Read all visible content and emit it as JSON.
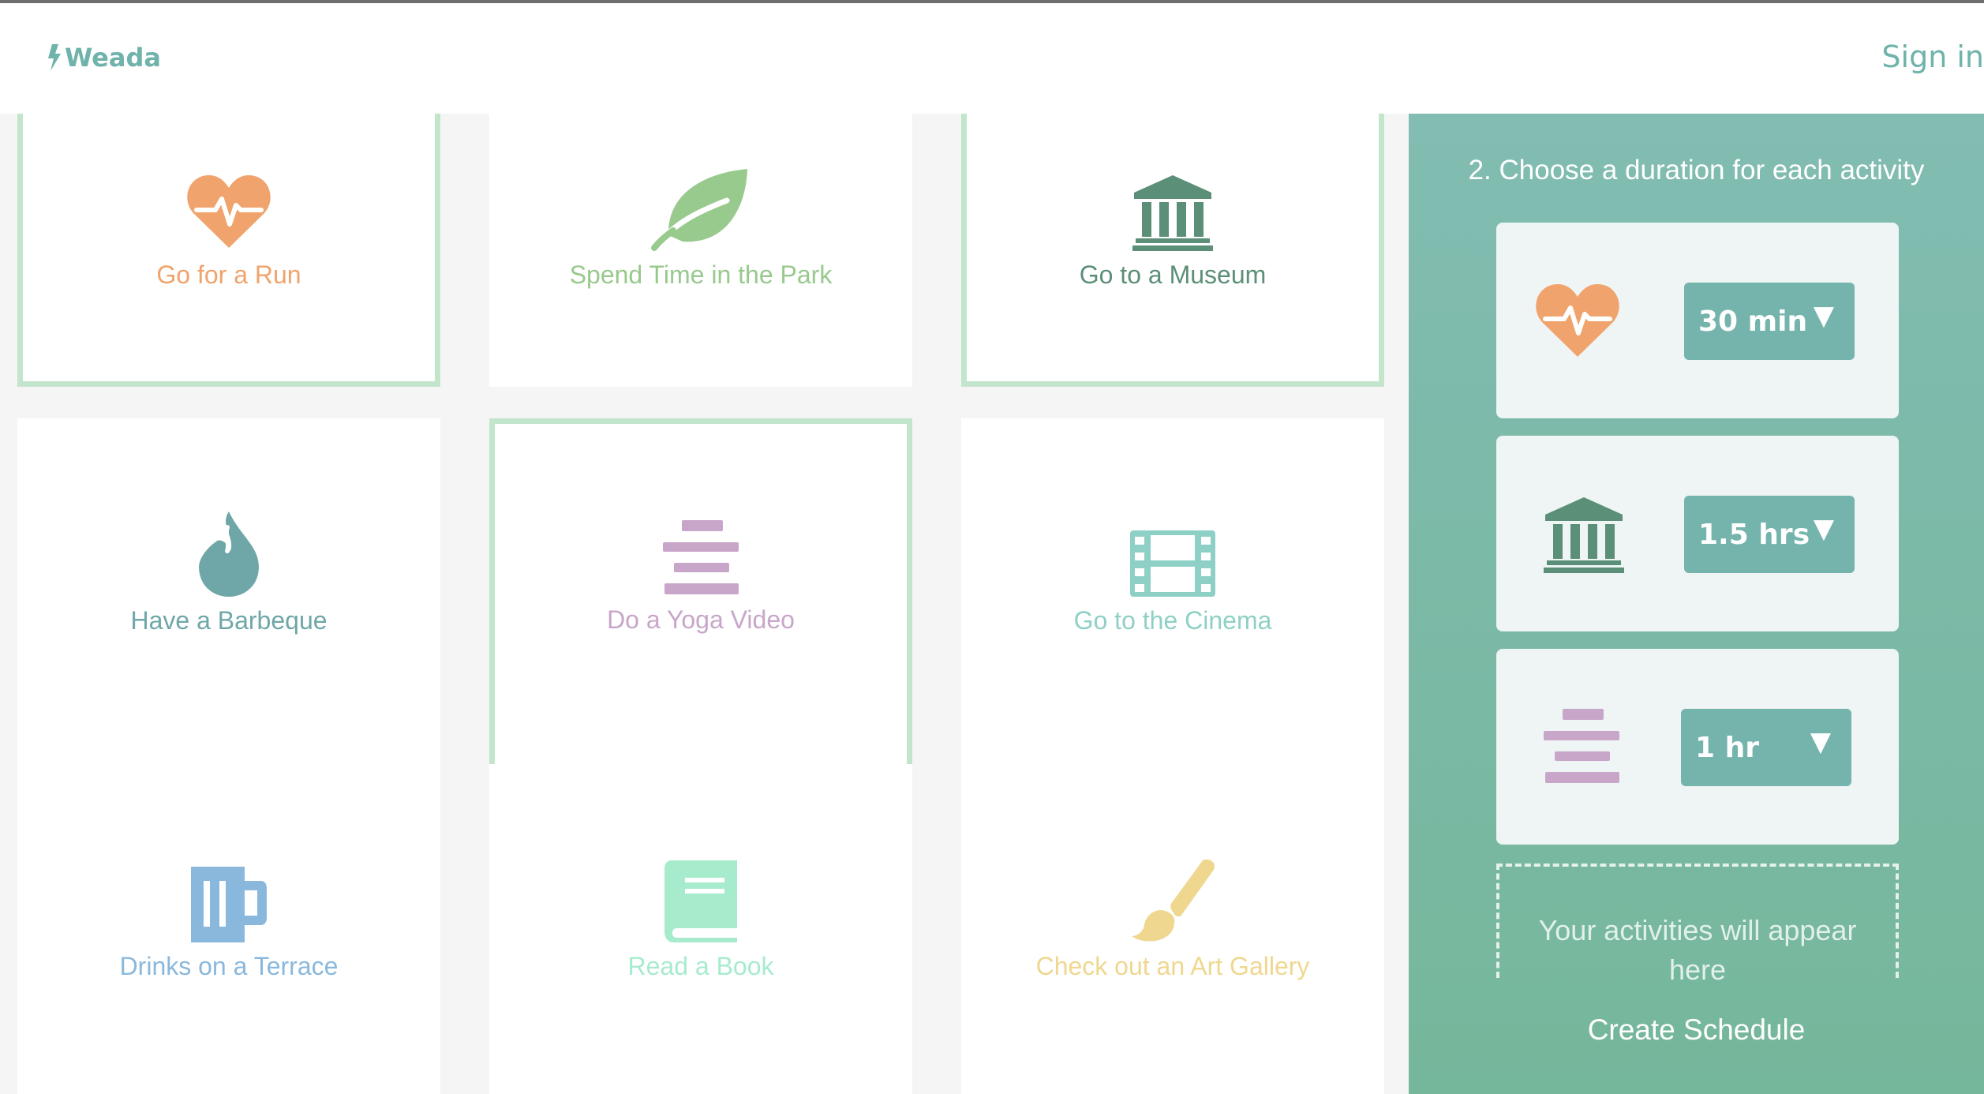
{
  "nav": {
    "logo_text": "Weada",
    "signin_label": "Sign in"
  },
  "activities": [
    {
      "label": "Go for a Run",
      "icon": "heartbeat-icon",
      "color": "#f0a36c",
      "selected": true
    },
    {
      "label": "Spend Time in the Park",
      "icon": "leaf-icon",
      "color": "#98c98d",
      "selected": false
    },
    {
      "label": "Go to a Museum",
      "icon": "museum-icon",
      "color": "#5c8f77",
      "selected": true
    },
    {
      "label": "Have a Barbeque",
      "icon": "flame-icon",
      "color": "#6fa7a8",
      "selected": false
    },
    {
      "label": "Do a Yoga Video",
      "icon": "bars-icon",
      "color": "#c8a6c9",
      "selected": true
    },
    {
      "label": "Go to the Cinema",
      "icon": "film-icon",
      "color": "#8fd0c6",
      "selected": false
    },
    {
      "label": "Drinks on a Terrace",
      "icon": "mug-icon",
      "color": "#8ab8dc",
      "selected": false
    },
    {
      "label": "Read a Book",
      "icon": "book-icon",
      "color": "#a7ebcd",
      "selected": false
    },
    {
      "label": "Check out an Art Gallery",
      "icon": "paintbrush-icon",
      "color": "#efd78f",
      "selected": false
    }
  ],
  "panel": {
    "title": "2. Choose a duration for each activity",
    "durations": [
      {
        "icon": "heartbeat-icon",
        "value": "30 min",
        "arrow": "▼"
      },
      {
        "icon": "museum-icon",
        "value": "1.5 hrs",
        "arrow": "▼"
      },
      {
        "icon": "bars-icon",
        "value": "1 hr",
        "arrow": "▼"
      }
    ],
    "placeholder_line1": "Your activities will appear",
    "placeholder_line2": "here",
    "create_label": "Create Schedule"
  }
}
